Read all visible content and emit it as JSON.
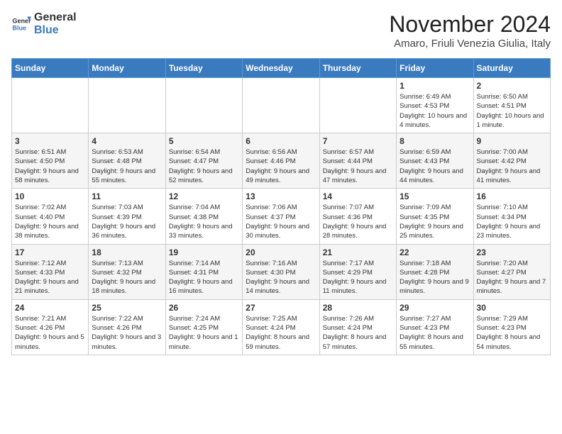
{
  "logo": {
    "text_general": "General",
    "text_blue": "Blue"
  },
  "header": {
    "month_year": "November 2024",
    "location": "Amaro, Friuli Venezia Giulia, Italy"
  },
  "weekdays": [
    "Sunday",
    "Monday",
    "Tuesday",
    "Wednesday",
    "Thursday",
    "Friday",
    "Saturday"
  ],
  "weeks": [
    [
      {
        "day": "",
        "info": ""
      },
      {
        "day": "",
        "info": ""
      },
      {
        "day": "",
        "info": ""
      },
      {
        "day": "",
        "info": ""
      },
      {
        "day": "",
        "info": ""
      },
      {
        "day": "1",
        "info": "Sunrise: 6:49 AM\nSunset: 4:53 PM\nDaylight: 10 hours and 4 minutes."
      },
      {
        "day": "2",
        "info": "Sunrise: 6:50 AM\nSunset: 4:51 PM\nDaylight: 10 hours and 1 minute."
      }
    ],
    [
      {
        "day": "3",
        "info": "Sunrise: 6:51 AM\nSunset: 4:50 PM\nDaylight: 9 hours and 58 minutes."
      },
      {
        "day": "4",
        "info": "Sunrise: 6:53 AM\nSunset: 4:48 PM\nDaylight: 9 hours and 55 minutes."
      },
      {
        "day": "5",
        "info": "Sunrise: 6:54 AM\nSunset: 4:47 PM\nDaylight: 9 hours and 52 minutes."
      },
      {
        "day": "6",
        "info": "Sunrise: 6:56 AM\nSunset: 4:46 PM\nDaylight: 9 hours and 49 minutes."
      },
      {
        "day": "7",
        "info": "Sunrise: 6:57 AM\nSunset: 4:44 PM\nDaylight: 9 hours and 47 minutes."
      },
      {
        "day": "8",
        "info": "Sunrise: 6:59 AM\nSunset: 4:43 PM\nDaylight: 9 hours and 44 minutes."
      },
      {
        "day": "9",
        "info": "Sunrise: 7:00 AM\nSunset: 4:42 PM\nDaylight: 9 hours and 41 minutes."
      }
    ],
    [
      {
        "day": "10",
        "info": "Sunrise: 7:02 AM\nSunset: 4:40 PM\nDaylight: 9 hours and 38 minutes."
      },
      {
        "day": "11",
        "info": "Sunrise: 7:03 AM\nSunset: 4:39 PM\nDaylight: 9 hours and 36 minutes."
      },
      {
        "day": "12",
        "info": "Sunrise: 7:04 AM\nSunset: 4:38 PM\nDaylight: 9 hours and 33 minutes."
      },
      {
        "day": "13",
        "info": "Sunrise: 7:06 AM\nSunset: 4:37 PM\nDaylight: 9 hours and 30 minutes."
      },
      {
        "day": "14",
        "info": "Sunrise: 7:07 AM\nSunset: 4:36 PM\nDaylight: 9 hours and 28 minutes."
      },
      {
        "day": "15",
        "info": "Sunrise: 7:09 AM\nSunset: 4:35 PM\nDaylight: 9 hours and 25 minutes."
      },
      {
        "day": "16",
        "info": "Sunrise: 7:10 AM\nSunset: 4:34 PM\nDaylight: 9 hours and 23 minutes."
      }
    ],
    [
      {
        "day": "17",
        "info": "Sunrise: 7:12 AM\nSunset: 4:33 PM\nDaylight: 9 hours and 21 minutes."
      },
      {
        "day": "18",
        "info": "Sunrise: 7:13 AM\nSunset: 4:32 PM\nDaylight: 9 hours and 18 minutes."
      },
      {
        "day": "19",
        "info": "Sunrise: 7:14 AM\nSunset: 4:31 PM\nDaylight: 9 hours and 16 minutes."
      },
      {
        "day": "20",
        "info": "Sunrise: 7:16 AM\nSunset: 4:30 PM\nDaylight: 9 hours and 14 minutes."
      },
      {
        "day": "21",
        "info": "Sunrise: 7:17 AM\nSunset: 4:29 PM\nDaylight: 9 hours and 11 minutes."
      },
      {
        "day": "22",
        "info": "Sunrise: 7:18 AM\nSunset: 4:28 PM\nDaylight: 9 hours and 9 minutes."
      },
      {
        "day": "23",
        "info": "Sunrise: 7:20 AM\nSunset: 4:27 PM\nDaylight: 9 hours and 7 minutes."
      }
    ],
    [
      {
        "day": "24",
        "info": "Sunrise: 7:21 AM\nSunset: 4:26 PM\nDaylight: 9 hours and 5 minutes."
      },
      {
        "day": "25",
        "info": "Sunrise: 7:22 AM\nSunset: 4:26 PM\nDaylight: 9 hours and 3 minutes."
      },
      {
        "day": "26",
        "info": "Sunrise: 7:24 AM\nSunset: 4:25 PM\nDaylight: 9 hours and 1 minute."
      },
      {
        "day": "27",
        "info": "Sunrise: 7:25 AM\nSunset: 4:24 PM\nDaylight: 8 hours and 59 minutes."
      },
      {
        "day": "28",
        "info": "Sunrise: 7:26 AM\nSunset: 4:24 PM\nDaylight: 8 hours and 57 minutes."
      },
      {
        "day": "29",
        "info": "Sunrise: 7:27 AM\nSunset: 4:23 PM\nDaylight: 8 hours and 55 minutes."
      },
      {
        "day": "30",
        "info": "Sunrise: 7:29 AM\nSunset: 4:23 PM\nDaylight: 8 hours and 54 minutes."
      }
    ]
  ]
}
